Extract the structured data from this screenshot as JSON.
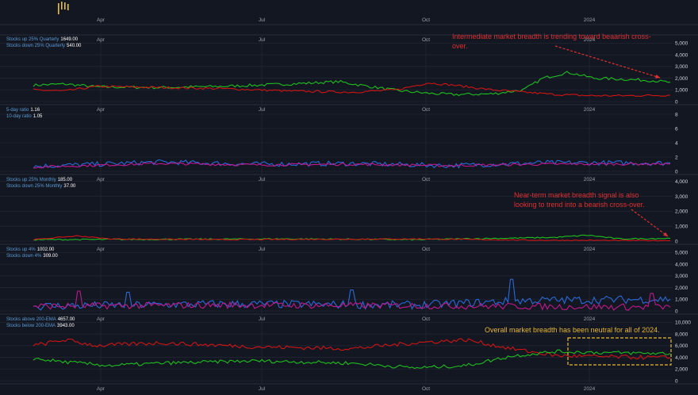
{
  "theme": {
    "background": "#131722",
    "grid": "#232733",
    "axis_text": "#9aa0a6",
    "green": "#1fbf1f",
    "red": "#d01414",
    "blue": "#2a6ad8",
    "magenta": "#c0188c",
    "annotation_red": "#e03030",
    "annotation_gold": "#e8b830"
  },
  "x_labels": [
    "Apr",
    "Jul",
    "Oct",
    "2024"
  ],
  "chart_data": [
    {
      "type": "line",
      "legend": [
        {
          "label": "Stocks up 25% Quarterly",
          "value": "1649.00"
        },
        {
          "label": "Stocks down 25% Quarterly",
          "value": "540.00"
        }
      ],
      "yticks": [
        "0",
        "1,000",
        "2,000",
        "3,000",
        "4,000",
        "5,000"
      ],
      "ylim": [
        0,
        5500
      ],
      "annotation": "Intermediate market breadth is trending toward beaarish cross-over.",
      "series": [
        {
          "color": "green",
          "anchors": [
            [
              0,
              1400
            ],
            [
              0.05,
              1500
            ],
            [
              0.1,
              1250
            ],
            [
              0.2,
              1200
            ],
            [
              0.3,
              1300
            ],
            [
              0.4,
              1500
            ],
            [
              0.48,
              1700
            ],
            [
              0.52,
              1350
            ],
            [
              0.57,
              950
            ],
            [
              0.62,
              700
            ],
            [
              0.66,
              600
            ],
            [
              0.72,
              650
            ],
            [
              0.77,
              1000
            ],
            [
              0.8,
              2000
            ],
            [
              0.84,
              2500
            ],
            [
              0.88,
              2000
            ],
            [
              0.93,
              1900
            ],
            [
              0.97,
              1800
            ],
            [
              1,
              1649
            ]
          ],
          "noise": 120
        },
        {
          "color": "red",
          "anchors": [
            [
              0,
              1000
            ],
            [
              0.05,
              900
            ],
            [
              0.1,
              1300
            ],
            [
              0.2,
              1200
            ],
            [
              0.3,
              1100
            ],
            [
              0.4,
              900
            ],
            [
              0.5,
              800
            ],
            [
              0.57,
              1000
            ],
            [
              0.62,
              1600
            ],
            [
              0.66,
              1400
            ],
            [
              0.72,
              1000
            ],
            [
              0.77,
              800
            ],
            [
              0.82,
              600
            ],
            [
              0.88,
              500
            ],
            [
              0.93,
              500
            ],
            [
              1,
              540
            ]
          ],
          "noise": 90
        }
      ]
    },
    {
      "type": "line",
      "legend": [
        {
          "label": "5-day ratio",
          "value": "1.16"
        },
        {
          "label": "10-day ratio",
          "value": "1.05"
        }
      ],
      "yticks": [
        "0",
        "2",
        "4",
        "6",
        "8"
      ],
      "ylim": [
        0,
        9
      ],
      "series": [
        {
          "color": "blue",
          "anchors": [
            [
              0,
              0.7
            ],
            [
              0.2,
              1.3
            ],
            [
              0.35,
              1.0
            ],
            [
              0.5,
              1.1
            ],
            [
              0.65,
              0.8
            ],
            [
              0.8,
              1.2
            ],
            [
              1,
              1.16
            ]
          ],
          "noise": 0.35
        },
        {
          "color": "magenta",
          "anchors": [
            [
              0,
              0.6
            ],
            [
              0.2,
              1.1
            ],
            [
              0.35,
              0.9
            ],
            [
              0.5,
              1.0
            ],
            [
              0.65,
              0.8
            ],
            [
              0.8,
              1.0
            ],
            [
              1,
              1.05
            ]
          ],
          "noise": 0.18
        }
      ]
    },
    {
      "type": "line",
      "legend": [
        {
          "label": "Stocks up 25% Monthly",
          "value": "185.00"
        },
        {
          "label": "Stocks down 25% Monthly",
          "value": "37.00"
        }
      ],
      "yticks": [
        "0",
        "1,000",
        "2,000",
        "3,000",
        "4,000"
      ],
      "ylim": [
        0,
        4300
      ],
      "annotation": "Near-term market breadth signal is also looking to trend into a bearish cross-over.",
      "series": [
        {
          "color": "green",
          "anchors": [
            [
              0,
              100
            ],
            [
              0.2,
              120
            ],
            [
              0.4,
              150
            ],
            [
              0.6,
              100
            ],
            [
              0.75,
              200
            ],
            [
              0.82,
              250
            ],
            [
              0.87,
              400
            ],
            [
              0.92,
              150
            ],
            [
              1,
              185
            ]
          ],
          "noise": 40
        },
        {
          "color": "red",
          "anchors": [
            [
              0,
              100
            ],
            [
              0.04,
              250
            ],
            [
              0.07,
              350
            ],
            [
              0.12,
              150
            ],
            [
              0.3,
              100
            ],
            [
              0.6,
              150
            ],
            [
              0.8,
              60
            ],
            [
              1,
              37
            ]
          ],
          "noise": 30
        }
      ]
    },
    {
      "type": "line",
      "legend": [
        {
          "label": "Stocks up 4%",
          "value": "1002.00"
        },
        {
          "label": "Stocks down 4%",
          "value": "309.00"
        }
      ],
      "yticks": [
        "0",
        "1,000",
        "2,000",
        "3,000",
        "4,000",
        "5,000"
      ],
      "ylim": [
        0,
        5500
      ],
      "series": [
        {
          "color": "blue",
          "anchors": [
            [
              0,
              400
            ],
            [
              0.3,
              600
            ],
            [
              0.6,
              500
            ],
            [
              0.78,
              900
            ],
            [
              1,
              1002
            ]
          ],
          "noise": 350,
          "spikes": [
            [
              0.75,
              2700
            ],
            [
              0.5,
              1800
            ],
            [
              0.15,
              1600
            ]
          ]
        },
        {
          "color": "magenta",
          "anchors": [
            [
              0,
              400
            ],
            [
              0.3,
              500
            ],
            [
              0.6,
              450
            ],
            [
              1,
              309
            ]
          ],
          "noise": 280,
          "spikes": [
            [
              0.07,
              1700
            ],
            [
              0.97,
              1500
            ]
          ]
        }
      ]
    },
    {
      "type": "line",
      "legend": [
        {
          "label": "Stocks above 200-EMA",
          "value": "4657.00"
        },
        {
          "label": "Stocks below 200-EMA",
          "value": "3943.00"
        }
      ],
      "yticks": [
        "0",
        "2,000",
        "4,000",
        "6,000",
        "8,000",
        "10,000"
      ],
      "ylim": [
        0,
        11000
      ],
      "annotation": "Overall market breadth has been neutral for all of 2024.",
      "series": [
        {
          "color": "red",
          "anchors": [
            [
              0,
              6000
            ],
            [
              0.05,
              7000
            ],
            [
              0.1,
              6000
            ],
            [
              0.2,
              6500
            ],
            [
              0.35,
              5800
            ],
            [
              0.5,
              5500
            ],
            [
              0.6,
              6500
            ],
            [
              0.68,
              7000
            ],
            [
              0.75,
              5500
            ],
            [
              0.82,
              4300
            ],
            [
              0.9,
              4100
            ],
            [
              1,
              3943
            ]
          ],
          "noise": 350
        },
        {
          "color": "green",
          "anchors": [
            [
              0,
              3800
            ],
            [
              0.05,
              3200
            ],
            [
              0.12,
              2600
            ],
            [
              0.2,
              3000
            ],
            [
              0.35,
              3400
            ],
            [
              0.5,
              3000
            ],
            [
              0.6,
              2200
            ],
            [
              0.68,
              2600
            ],
            [
              0.75,
              4200
            ],
            [
              0.82,
              5000
            ],
            [
              0.9,
              4800
            ],
            [
              1,
              4657
            ]
          ],
          "noise": 300
        }
      ]
    }
  ]
}
